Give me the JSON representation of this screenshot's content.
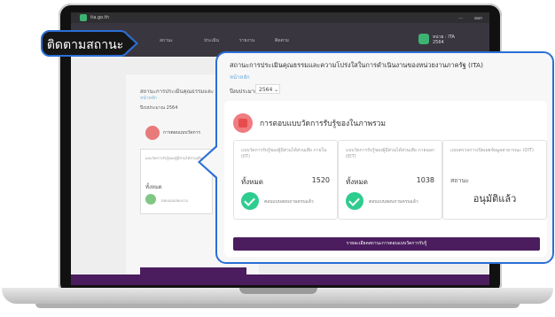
{
  "colors": {
    "accent_blue": "#2b6fd6",
    "purple": "#4b1d5e",
    "green": "#2ecc8f",
    "red": "#e74c4c"
  },
  "label": {
    "text": "ติดตามสถานะ"
  },
  "app": {
    "topbar": {
      "logo_text": "ita.go.th",
      "bell_text": "...",
      "signout_text": "ออก"
    },
    "nav": {
      "items": [
        "สถานะ",
        "ประเมิน",
        "รายงาน",
        "ติดตาม"
      ],
      "user_lines": [
        "หน่วย : ITA",
        "2564"
      ]
    },
    "inner": {
      "title": "สถานะการประเมินคุณธรรมและ",
      "subtitle": "หน้าหลัก",
      "year": "ปีงบประมาณ 2564",
      "red_title": "การตอบแบบวัดการ",
      "box_text": "แบบวัดการรับรู้ของผู้มีส่วนได้ส่วนเสีย ภายใน (IIT)",
      "box_all": "ทั้งหมด",
      "box_status": "ตอบแบบสอบถาม"
    }
  },
  "popup": {
    "title": "สถานะการประเมินคุณธรรมและความโปร่งใสในการดำเนินงานของหน่วยงานภาครัฐ (ITA)",
    "subtitle": "หน้าหลัก",
    "year_label": "ปีงบประมาณ",
    "year_value": "2564 ⌄",
    "section_title": "การตอบแบบวัดการรับรู้ของในภาพรวม",
    "boxes": [
      {
        "title": "แบบวัดการรับรู้ของผู้มีส่วนได้ส่วนเสีย ภายใน (IIT)",
        "all_label": "ทั้งหมด",
        "count": "1520",
        "status": "ตอบแบบสอบถามครบแล้ว"
      },
      {
        "title": "แบบวัดการรับรู้ของผู้มีส่วนได้ส่วนเสีย ภายนอก (EIT)",
        "all_label": "ทั้งหมด",
        "count": "1038",
        "status": "ตอบแบบสอบถามครบแล้ว"
      },
      {
        "title": "แบบตรวจการเปิดเผยข้อมูลสาธารณะ (OIT)",
        "status_label": "สถานะ",
        "approved": "อนุมัติแล้ว"
      }
    ],
    "bottom_button": "รายละเอียดสถานะการตอบแบบวัดการรับรู้"
  }
}
